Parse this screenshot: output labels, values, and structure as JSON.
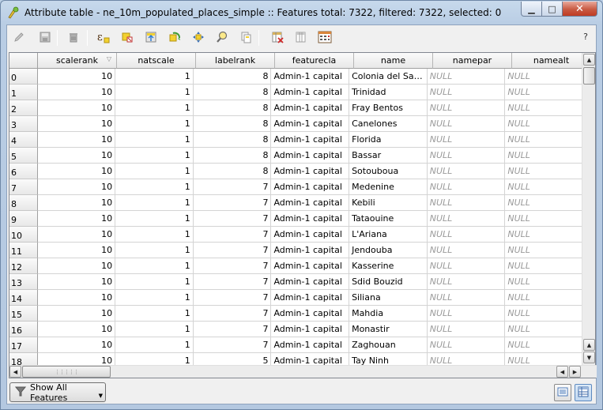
{
  "window": {
    "title": "Attribute table - ne_10m_populated_places_simple :: Features total: 7322, filtered: 7322, selected: 0",
    "minimize_label": "▁",
    "maximize_label": "□",
    "close_label": "✕"
  },
  "toolbar": {
    "buttons": [
      {
        "name": "toggle-editing-icon"
      },
      {
        "name": "save-edits-icon"
      },
      {
        "name": "delete-selected-icon"
      },
      {
        "name": "select-by-expression-icon"
      },
      {
        "name": "unselect-all-icon"
      },
      {
        "name": "move-selection-to-top-icon"
      },
      {
        "name": "invert-selection-icon"
      },
      {
        "name": "pan-to-selected-icon"
      },
      {
        "name": "zoom-to-selected-icon"
      },
      {
        "name": "copy-selected-rows-icon"
      },
      {
        "name": "delete-column-icon"
      },
      {
        "name": "new-column-icon"
      },
      {
        "name": "field-calculator-icon"
      }
    ],
    "help_label": "?"
  },
  "table": {
    "columns": [
      "scalerank",
      "natscale",
      "labelrank",
      "featurecla",
      "name",
      "namepar",
      "namealt"
    ],
    "rows": [
      {
        "id": "0",
        "scalerank": "10",
        "natscale": "1",
        "labelrank": "8",
        "featurecla": "Admin-1 capital",
        "name": "Colonia del Sacra...",
        "namepar": "NULL",
        "namealt": "NULL"
      },
      {
        "id": "1",
        "scalerank": "10",
        "natscale": "1",
        "labelrank": "8",
        "featurecla": "Admin-1 capital",
        "name": "Trinidad",
        "namepar": "NULL",
        "namealt": "NULL"
      },
      {
        "id": "2",
        "scalerank": "10",
        "natscale": "1",
        "labelrank": "8",
        "featurecla": "Admin-1 capital",
        "name": "Fray Bentos",
        "namepar": "NULL",
        "namealt": "NULL"
      },
      {
        "id": "3",
        "scalerank": "10",
        "natscale": "1",
        "labelrank": "8",
        "featurecla": "Admin-1 capital",
        "name": "Canelones",
        "namepar": "NULL",
        "namealt": "NULL"
      },
      {
        "id": "4",
        "scalerank": "10",
        "natscale": "1",
        "labelrank": "8",
        "featurecla": "Admin-1 capital",
        "name": "Florida",
        "namepar": "NULL",
        "namealt": "NULL"
      },
      {
        "id": "5",
        "scalerank": "10",
        "natscale": "1",
        "labelrank": "8",
        "featurecla": "Admin-1 capital",
        "name": "Bassar",
        "namepar": "NULL",
        "namealt": "NULL"
      },
      {
        "id": "6",
        "scalerank": "10",
        "natscale": "1",
        "labelrank": "8",
        "featurecla": "Admin-1 capital",
        "name": "Sotouboua",
        "namepar": "NULL",
        "namealt": "NULL"
      },
      {
        "id": "7",
        "scalerank": "10",
        "natscale": "1",
        "labelrank": "7",
        "featurecla": "Admin-1 capital",
        "name": "Medenine",
        "namepar": "NULL",
        "namealt": "NULL"
      },
      {
        "id": "8",
        "scalerank": "10",
        "natscale": "1",
        "labelrank": "7",
        "featurecla": "Admin-1 capital",
        "name": "Kebili",
        "namepar": "NULL",
        "namealt": "NULL"
      },
      {
        "id": "9",
        "scalerank": "10",
        "natscale": "1",
        "labelrank": "7",
        "featurecla": "Admin-1 capital",
        "name": "Tataouine",
        "namepar": "NULL",
        "namealt": "NULL"
      },
      {
        "id": "10",
        "scalerank": "10",
        "natscale": "1",
        "labelrank": "7",
        "featurecla": "Admin-1 capital",
        "name": "L'Ariana",
        "namepar": "NULL",
        "namealt": "NULL"
      },
      {
        "id": "11",
        "scalerank": "10",
        "natscale": "1",
        "labelrank": "7",
        "featurecla": "Admin-1 capital",
        "name": "Jendouba",
        "namepar": "NULL",
        "namealt": "NULL"
      },
      {
        "id": "12",
        "scalerank": "10",
        "natscale": "1",
        "labelrank": "7",
        "featurecla": "Admin-1 capital",
        "name": "Kasserine",
        "namepar": "NULL",
        "namealt": "NULL"
      },
      {
        "id": "13",
        "scalerank": "10",
        "natscale": "1",
        "labelrank": "7",
        "featurecla": "Admin-1 capital",
        "name": "Sdid Bouzid",
        "namepar": "NULL",
        "namealt": "NULL"
      },
      {
        "id": "14",
        "scalerank": "10",
        "natscale": "1",
        "labelrank": "7",
        "featurecla": "Admin-1 capital",
        "name": "Siliana",
        "namepar": "NULL",
        "namealt": "NULL"
      },
      {
        "id": "15",
        "scalerank": "10",
        "natscale": "1",
        "labelrank": "7",
        "featurecla": "Admin-1 capital",
        "name": "Mahdia",
        "namepar": "NULL",
        "namealt": "NULL"
      },
      {
        "id": "16",
        "scalerank": "10",
        "natscale": "1",
        "labelrank": "7",
        "featurecla": "Admin-1 capital",
        "name": "Monastir",
        "namepar": "NULL",
        "namealt": "NULL"
      },
      {
        "id": "17",
        "scalerank": "10",
        "natscale": "1",
        "labelrank": "7",
        "featurecla": "Admin-1 capital",
        "name": "Zaghouan",
        "namepar": "NULL",
        "namealt": "NULL"
      },
      {
        "id": "18",
        "scalerank": "10",
        "natscale": "1",
        "labelrank": "5",
        "featurecla": "Admin-1 capital",
        "name": "Tay Ninh",
        "namepar": "NULL",
        "namealt": "NULL"
      }
    ],
    "sort_indicator": "▽",
    "hscroll_grip": "⋮⋮⋮⋮⋮"
  },
  "bottom": {
    "filter_button_label": "Show All Features",
    "filter_caret": "▼"
  }
}
